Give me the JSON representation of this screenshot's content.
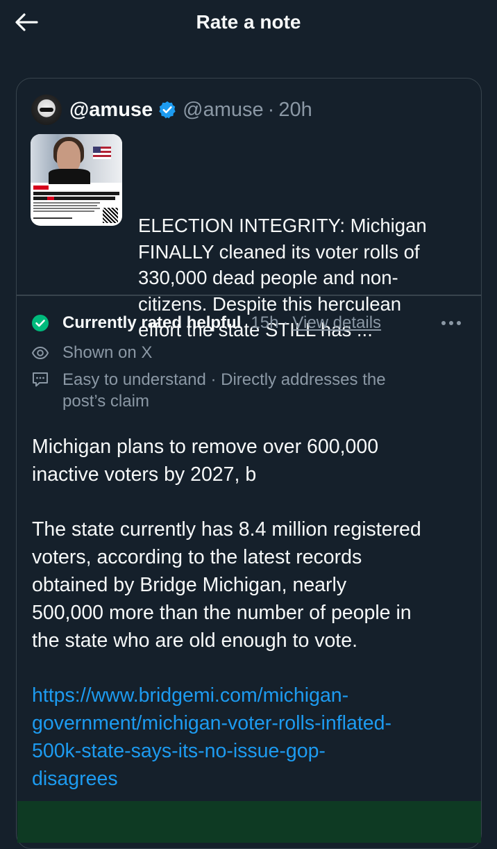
{
  "header": {
    "title": "Rate a note"
  },
  "post": {
    "display_name": "@amuse",
    "handle": "@amuse",
    "separator": "·",
    "time": "20h",
    "text_lines": [
      "ELECTION INTEGRITY: Michigan",
      "FINALLY cleaned its voter rolls of",
      "330,000 dead people and non-",
      "citizens. Despite this herculean",
      "effort the state STILL has ..."
    ]
  },
  "note": {
    "status_label": "Currently rated helpful",
    "status_time": "15h",
    "status_separator": "·",
    "view_details": "View details",
    "shown_on": "Shown on X",
    "tags_line1": "Easy to understand · Directly addresses the",
    "tags_line2": "post’s claim",
    "body_p1_line1": "Michigan plans to remove over 600,000",
    "body_p1_line2": "inactive voters by 2027, b",
    "body_p2_lines": [
      "The state currently has 8.4 million registered",
      "voters, according to the latest records",
      "obtained by Bridge Michigan, nearly",
      "500,000 more than the number of people in",
      "the state who are old enough to vote."
    ],
    "link_lines": [
      "https://www.bridgemi.com/michigan-",
      "government/michigan-voter-rolls-inflated-",
      "500k-state-says-its-no-issue-gop-",
      "disagrees"
    ]
  },
  "colors": {
    "background": "#15202b",
    "border": "#38444d",
    "secondary_text": "#8b98a5",
    "link": "#1d9bf0",
    "verified": "#1d9bf0",
    "helpful_green": "#00ba7c"
  },
  "icons": {
    "back": "arrow-left-icon",
    "verified": "verified-badge-icon",
    "helpful": "check-circle-icon",
    "more": "more-horizontal-icon",
    "shown": "eye-icon",
    "tags": "comment-icon"
  }
}
